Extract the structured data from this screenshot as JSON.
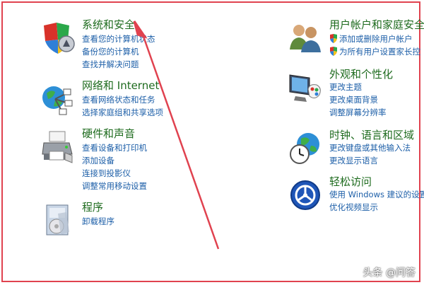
{
  "categories": {
    "system": {
      "title": "系统和安全",
      "links": [
        "查看您的计算机状态",
        "备份您的计算机",
        "查找并解决问题"
      ]
    },
    "network": {
      "title": "网络和 Internet",
      "links": [
        "查看网络状态和任务",
        "选择家庭组和共享选项"
      ]
    },
    "hardware": {
      "title": "硬件和声音",
      "links": [
        "查看设备和打印机",
        "添加设备",
        "连接到投影仪",
        "调整常用移动设置"
      ]
    },
    "programs": {
      "title": "程序",
      "links": [
        "卸载程序"
      ]
    },
    "users": {
      "title": "用户帐户和家庭安全",
      "links": [
        "添加或删除用户帐户",
        "为所有用户设置家长控"
      ]
    },
    "appearance": {
      "title": "外观和个性化",
      "links": [
        "更改主题",
        "更改桌面背景",
        "调整屏幕分辨率"
      ]
    },
    "clock": {
      "title": "时钟、语言和区域",
      "links": [
        "更改键盘或其他输入法",
        "更改显示语言"
      ]
    },
    "ease": {
      "title": "轻松访问",
      "links": [
        "使用 Windows 建议的设置",
        "优化视频显示"
      ]
    }
  },
  "watermark": "头条 @问答",
  "colors": {
    "category_title": "#1e6b1e",
    "link": "#1d5fa8",
    "annotation": "#e0424f"
  }
}
